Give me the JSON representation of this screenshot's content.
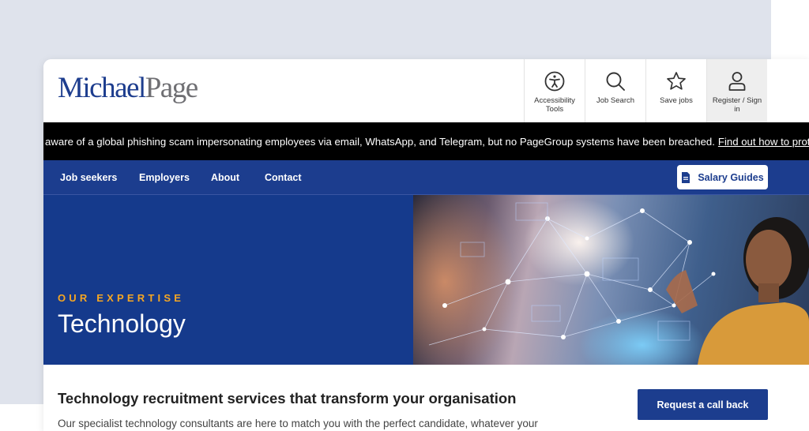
{
  "header": {
    "logo_part1": "Michael",
    "logo_part2": "Page",
    "tools": [
      {
        "label": "Accessibility Tools",
        "icon": "accessibility-icon"
      },
      {
        "label": "Job Search",
        "icon": "search-icon"
      },
      {
        "label": "Save jobs",
        "icon": "star-icon"
      },
      {
        "label": "Register / Sign in",
        "icon": "user-icon"
      }
    ]
  },
  "alert": {
    "text": "e aware of a global phishing scam impersonating employees via email, WhatsApp, and Telegram, but no PageGroup systems have been breached.",
    "link": "Find out how to protect yourself"
  },
  "nav": {
    "items": [
      "Job seekers",
      "Employers",
      "About",
      "Contact"
    ],
    "salary_label": "Salary Guides"
  },
  "hero": {
    "eyebrow": "OUR EXPERTISE",
    "title": "Technology"
  },
  "content": {
    "title": "Technology recruitment services that transform your organisation",
    "body": "Our specialist technology consultants are here to match you with the perfect candidate, whatever your",
    "cta": "Request a call back"
  },
  "colors": {
    "brand_blue": "#1c3d8e",
    "accent_orange": "#f5a623",
    "alert_bg": "#000000"
  }
}
